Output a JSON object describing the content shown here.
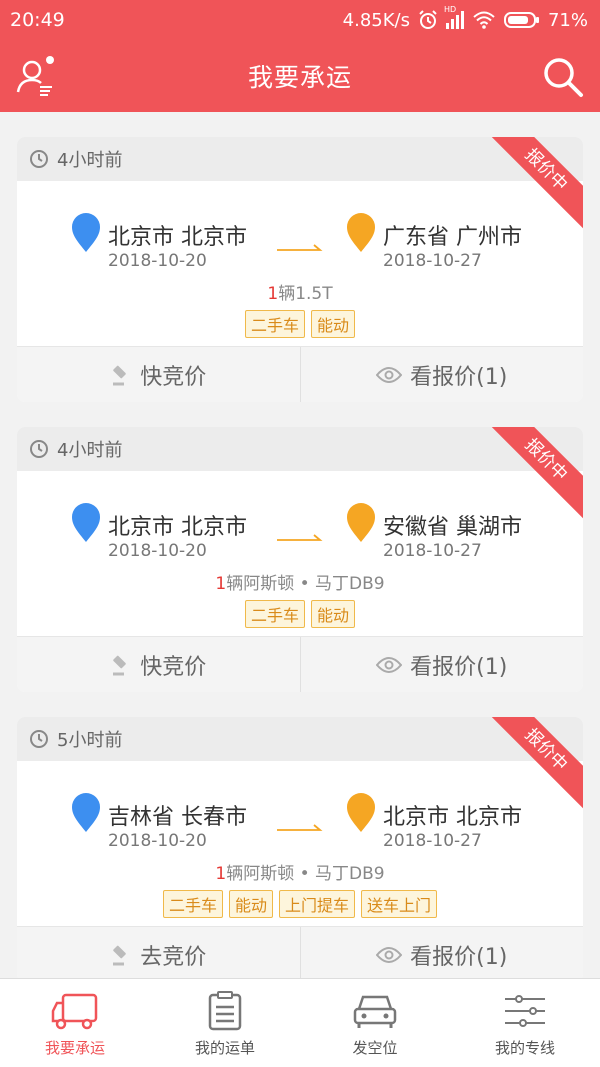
{
  "status_bar": {
    "time": "20:49",
    "speed": "4.85K/s",
    "signal_label": "HD",
    "battery": "71%"
  },
  "header": {
    "title": "我要承运"
  },
  "cards": [
    {
      "time": "4小时前",
      "badge": "报价中",
      "from_pin": "起",
      "to_pin": "终",
      "from_city": "北京市 北京市",
      "to_city": "广东省 广州市",
      "from_date": "2018-10-20",
      "to_date": "2018-10-27",
      "qty": "1",
      "goods": "辆1.5T",
      "tags": [
        "二手车",
        "能动"
      ],
      "action_left": "快竞价",
      "action_right": "看报价(1)"
    },
    {
      "time": "4小时前",
      "badge": "报价中",
      "from_pin": "起",
      "to_pin": "终",
      "from_city": "北京市 北京市",
      "to_city": "安徽省 巢湖市",
      "from_date": "2018-10-20",
      "to_date": "2018-10-27",
      "qty": "1",
      "goods": "辆阿斯顿 • 马丁DB9",
      "tags": [
        "二手车",
        "能动"
      ],
      "action_left": "快竞价",
      "action_right": "看报价(1)"
    },
    {
      "time": "5小时前",
      "badge": "报价中",
      "from_pin": "起",
      "to_pin": "终",
      "from_city": "吉林省 长春市",
      "to_city": "北京市 北京市",
      "from_date": "2018-10-20",
      "to_date": "2018-10-27",
      "qty": "1",
      "goods": "辆阿斯顿 • 马丁DB9",
      "tags": [
        "二手车",
        "能动",
        "上门提车",
        "送车上门"
      ],
      "action_left": "去竞价",
      "action_right": "看报价(1)"
    }
  ],
  "bottom_nav": [
    {
      "label": "我要承运",
      "icon": "truck-icon",
      "active": true
    },
    {
      "label": "我的运单",
      "icon": "clipboard-icon",
      "active": false
    },
    {
      "label": "发空位",
      "icon": "car-icon",
      "active": false
    },
    {
      "label": "我的专线",
      "icon": "sliders-icon",
      "active": false
    }
  ],
  "colors": {
    "brand": "#f05458",
    "start_pin": "#3d8ff0",
    "end_pin": "#f5a623",
    "tag": "#d98b1a"
  }
}
